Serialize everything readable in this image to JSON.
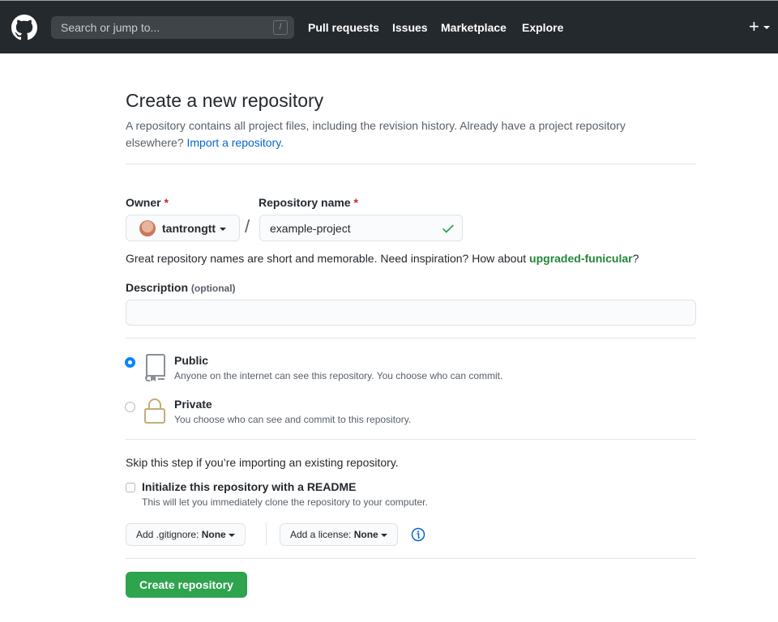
{
  "header": {
    "logo": "github-mark-icon",
    "search_placeholder": "Search or jump to...",
    "search_shortcut": "/",
    "nav": [
      "Pull requests",
      "Issues",
      "Marketplace",
      "Explore"
    ],
    "new_menu_icon": "plus"
  },
  "page": {
    "title": "Create a new repository",
    "subtitle": "A repository contains all project files, including the revision history. Already have a project repository elsewhere?",
    "import_link": "Import a repository."
  },
  "form": {
    "owner_label": "Owner",
    "required_mark": "*",
    "owner_value": "tantrongtt",
    "separator": "/",
    "repo_label": "Repository name",
    "repo_value": "example-project",
    "hint_prefix": "Great repository names are short and memorable. Need inspiration? How about",
    "hint_suggestion": "upgraded-funicular",
    "hint_suffix": "?",
    "description_label": "Description",
    "description_optional": "(optional)",
    "description_value": "",
    "visibility": [
      {
        "title": "Public",
        "desc": "Anyone on the internet can see this repository. You choose who can commit.",
        "selected": true
      },
      {
        "title": "Private",
        "desc": "You choose who can see and commit to this repository.",
        "selected": false
      }
    ],
    "skip_text": "Skip this step if you’re importing an existing repository.",
    "readme_label": "Initialize this repository with a README",
    "readme_desc": "This will let you immediately clone the repository to your computer.",
    "readme_checked": false,
    "gitignore_label": "Add .gitignore:",
    "gitignore_value": "None",
    "license_label": "Add a license:",
    "license_value": "None",
    "submit_label": "Create repository"
  },
  "colors": {
    "header_bg": "#24292e",
    "link": "#0366d6",
    "suggestion": "#22863a",
    "primary_button": "#2ea44f",
    "required": "#cb2431",
    "radio_selected": "#0a84ff"
  }
}
